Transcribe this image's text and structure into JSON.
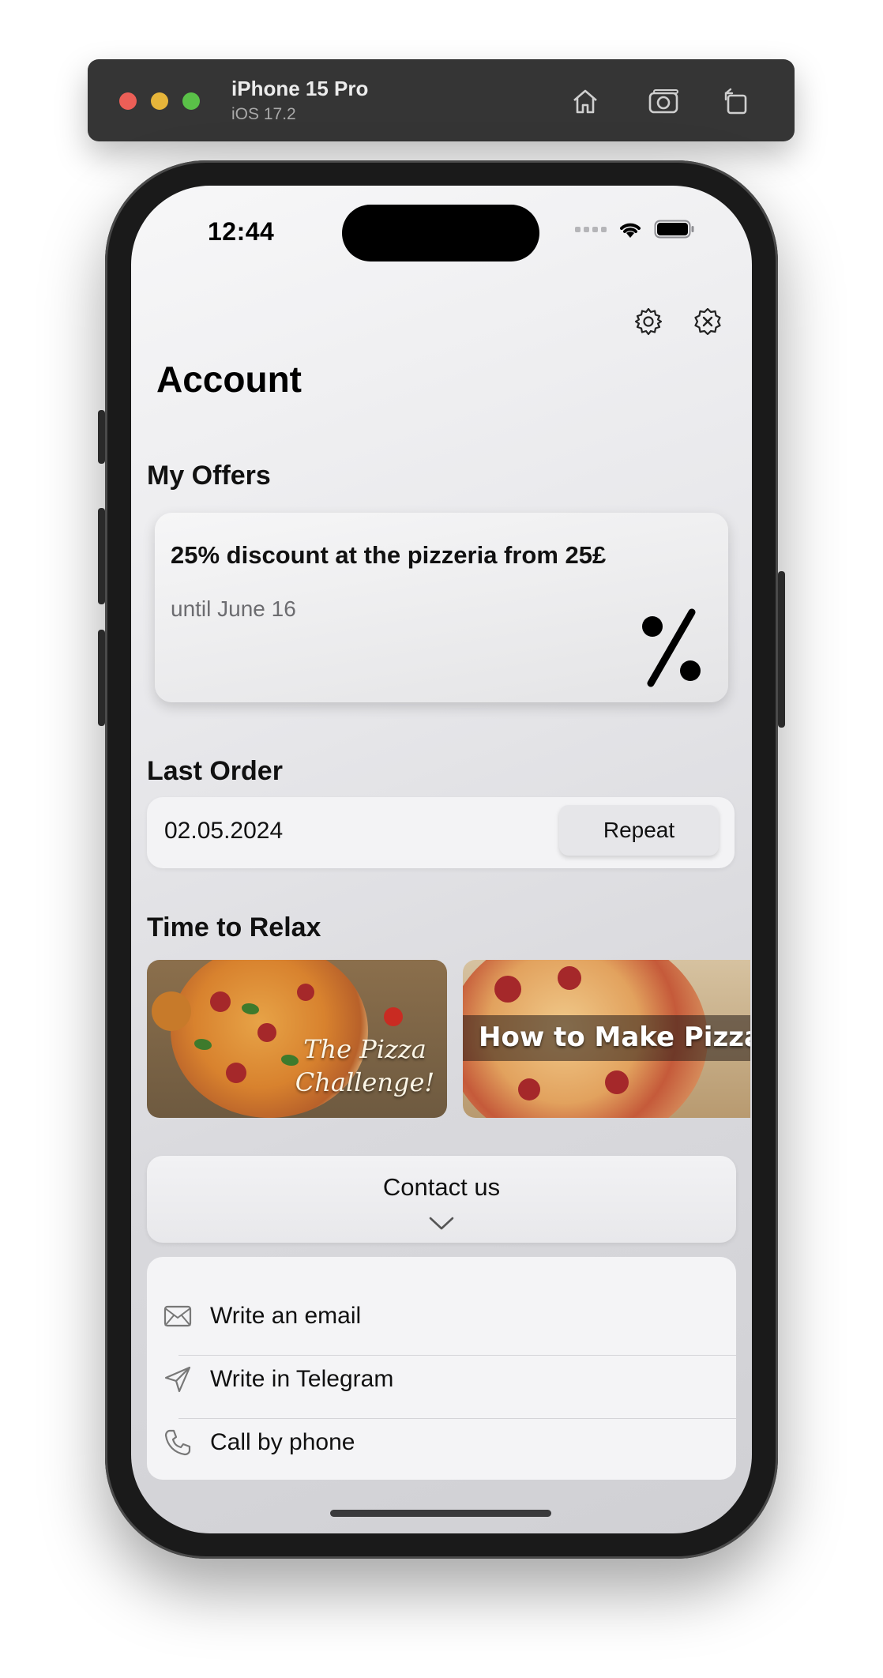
{
  "simulator": {
    "device_name": "iPhone 15 Pro",
    "os_version": "iOS 17.2",
    "icons": [
      "home-icon",
      "screenshot-icon",
      "rotate-icon"
    ]
  },
  "status_bar": {
    "time": "12:44",
    "icons": [
      "cellular-signal-icon",
      "wifi-icon",
      "battery-icon"
    ]
  },
  "toolbar": {
    "icons": [
      "gear-icon",
      "close-badge-icon"
    ]
  },
  "page": {
    "title": "Account"
  },
  "offers": {
    "section_title": "My Offers",
    "card": {
      "title": "25% discount at the pizzeria from 25£",
      "subtitle": "until June 16",
      "icon": "percent-icon"
    }
  },
  "last_order": {
    "section_title": "Last Order",
    "date": "02.05.2024",
    "repeat_label": "Repeat"
  },
  "relax": {
    "section_title": "Time to Relax",
    "cards": [
      {
        "caption": "The Pizza Challenge!"
      },
      {
        "caption": "How to Make Pizza"
      }
    ]
  },
  "contact": {
    "header_label": "Contact us",
    "items": [
      {
        "label": "Write an email",
        "icon": "envelope-icon"
      },
      {
        "label": "Write in Telegram",
        "icon": "paper-plane-icon"
      },
      {
        "label": "Call by phone",
        "icon": "phone-icon"
      }
    ]
  },
  "colors": {
    "simulator_bar": "#353535",
    "device_frame": "#1a1a1a",
    "screen_background": "#e8e8eb",
    "text_primary": "#111111",
    "text_secondary": "#6c6c70"
  }
}
